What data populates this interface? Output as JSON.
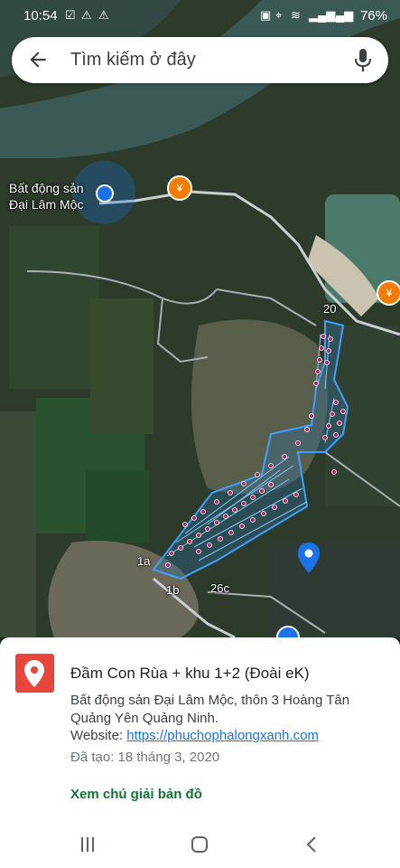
{
  "status_bar": {
    "time": "10:54",
    "battery": "76%"
  },
  "search": {
    "placeholder": "Tìm kiếm ở đây"
  },
  "map": {
    "location_label_line1": "Bất động sản",
    "location_label_line2": "Đại Lâm Mộc",
    "labels": {
      "l20": "20",
      "l1a": "1a",
      "l1b": "1b",
      "l26c": "26c"
    }
  },
  "place": {
    "title": "Đầm Con Rùa + khu 1+2 (Đoài eK)",
    "address_line1": "Bất động sản Đại Lâm Mộc, thôn 3 Hoàng Tân",
    "address_line2": "Quảng Yên Quảng Ninh.",
    "website_prefix": "Website: ",
    "website_url": "https://phuchophalongxanh.com",
    "created": "Đã tạo: 18 tháng 3, 2020",
    "legend_link": "Xem chú giải bản đồ"
  },
  "colors": {
    "accent_blue": "#1a73e8",
    "pin_red": "#e8453c",
    "legend_green": "#137333"
  }
}
